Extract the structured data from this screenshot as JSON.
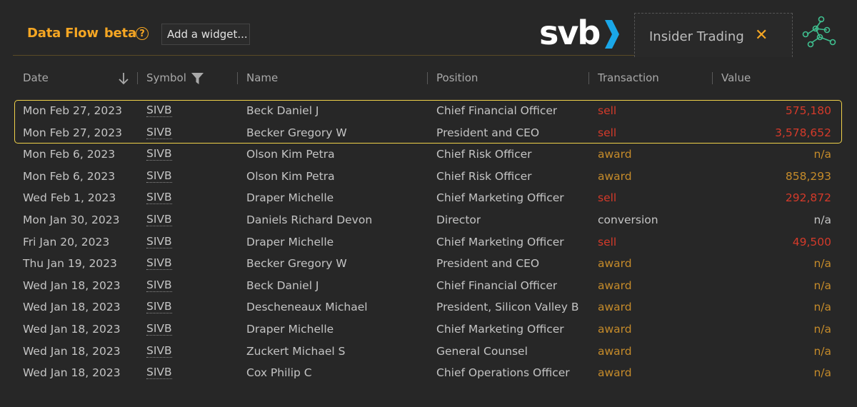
{
  "header": {
    "title": "Data Flow",
    "beta": "beta",
    "help_icon": "help-circle-icon",
    "add_widget_label": "Add a widget..."
  },
  "logo": {
    "text": "svb",
    "accent_color": "#1aa7e8"
  },
  "tab": {
    "label": "Insider Trading",
    "close_icon": "close-icon"
  },
  "network_icon": "network-graph-icon",
  "colors": {
    "accent": "#f5a623",
    "sell": "#d43a2a",
    "award": "#c58b2a",
    "highlight": "#f0d14a"
  },
  "table": {
    "columns": [
      "Date",
      "Symbol",
      "Name",
      "Position",
      "Transaction",
      "Value"
    ],
    "sort_icon": "arrow-down-icon",
    "filter_icon": "filter-icon",
    "rows": [
      {
        "date": "Mon Feb 27, 2023",
        "symbol": "SIVB",
        "name": "Beck Daniel J",
        "position": "Chief Financial Officer",
        "transaction": "sell",
        "value": "575,180"
      },
      {
        "date": "Mon Feb 27, 2023",
        "symbol": "SIVB",
        "name": "Becker Gregory W",
        "position": "President and CEO",
        "transaction": "sell",
        "value": "3,578,652"
      },
      {
        "date": "Mon Feb 6, 2023",
        "symbol": "SIVB",
        "name": "Olson Kim Petra",
        "position": "Chief Risk Officer",
        "transaction": "award",
        "value": "n/a"
      },
      {
        "date": "Mon Feb 6, 2023",
        "symbol": "SIVB",
        "name": "Olson Kim Petra",
        "position": "Chief Risk Officer",
        "transaction": "award",
        "value": "858,293"
      },
      {
        "date": "Wed Feb 1, 2023",
        "symbol": "SIVB",
        "name": "Draper Michelle",
        "position": "Chief Marketing Officer",
        "transaction": "sell",
        "value": "292,872"
      },
      {
        "date": "Mon Jan 30, 2023",
        "symbol": "SIVB",
        "name": "Daniels Richard Devon",
        "position": "Director",
        "transaction": "conversion",
        "value": "n/a"
      },
      {
        "date": "Fri Jan 20, 2023",
        "symbol": "SIVB",
        "name": "Draper Michelle",
        "position": "Chief Marketing Officer",
        "transaction": "sell",
        "value": "49,500"
      },
      {
        "date": "Thu Jan 19, 2023",
        "symbol": "SIVB",
        "name": "Becker Gregory W",
        "position": "President and CEO",
        "transaction": "award",
        "value": "n/a"
      },
      {
        "date": "Wed Jan 18, 2023",
        "symbol": "SIVB",
        "name": "Beck Daniel J",
        "position": "Chief Financial Officer",
        "transaction": "award",
        "value": "n/a"
      },
      {
        "date": "Wed Jan 18, 2023",
        "symbol": "SIVB",
        "name": "Descheneaux Michael",
        "position": "President, Silicon Valley B...",
        "transaction": "award",
        "value": "n/a"
      },
      {
        "date": "Wed Jan 18, 2023",
        "symbol": "SIVB",
        "name": "Draper Michelle",
        "position": "Chief Marketing Officer",
        "transaction": "award",
        "value": "n/a"
      },
      {
        "date": "Wed Jan 18, 2023",
        "symbol": "SIVB",
        "name": "Zuckert Michael S",
        "position": "General Counsel",
        "transaction": "award",
        "value": "n/a"
      },
      {
        "date": "Wed Jan 18, 2023",
        "symbol": "SIVB",
        "name": "Cox Philip C",
        "position": "Chief Operations Officer",
        "transaction": "award",
        "value": "n/a"
      }
    ]
  }
}
